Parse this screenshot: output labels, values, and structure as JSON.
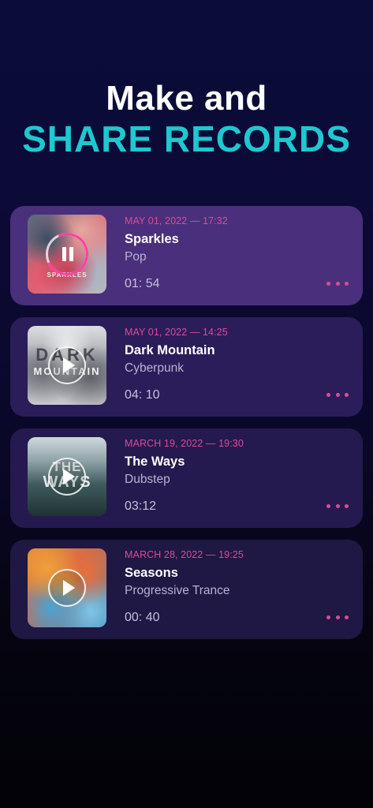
{
  "headline": {
    "line1": "Make and",
    "line2": "SHARE RECORDS"
  },
  "colors": {
    "accent_teal": "#1ec8cf",
    "accent_pink": "#d94c97",
    "progress_pink": "#ff3fa4",
    "active_card": "#4a2f7c"
  },
  "records": [
    {
      "date": "MAY 01, 2022 — 17:32",
      "title": "Sparkles",
      "genre": "Pop",
      "duration": "01: 54",
      "cover_text": "SPARKLES",
      "state": "playing",
      "control_icon": "pause-icon",
      "menu_icon": "more-dots-icon"
    },
    {
      "date": "MAY 01, 2022 — 14:25",
      "title": "Dark Mountain",
      "genre": "Cyberpunk",
      "duration": "04: 10",
      "cover_text_1": "DARK",
      "cover_text_2": "MOUNTAIN",
      "state": "paused",
      "control_icon": "play-icon",
      "menu_icon": "more-dots-icon"
    },
    {
      "date": "MARCH 19, 2022 — 19:30",
      "title": "The Ways",
      "genre": "Dubstep",
      "duration": "03:12",
      "cover_text_1": "THE",
      "cover_text_2": "WAYS",
      "state": "paused",
      "control_icon": "play-icon",
      "menu_icon": "more-dots-icon"
    },
    {
      "date": "MARCH 28, 2022 — 19:25",
      "title": "Seasons",
      "genre": "Progressive Trance",
      "duration": "00: 40",
      "state": "paused",
      "control_icon": "play-icon",
      "menu_icon": "more-dots-icon"
    }
  ]
}
